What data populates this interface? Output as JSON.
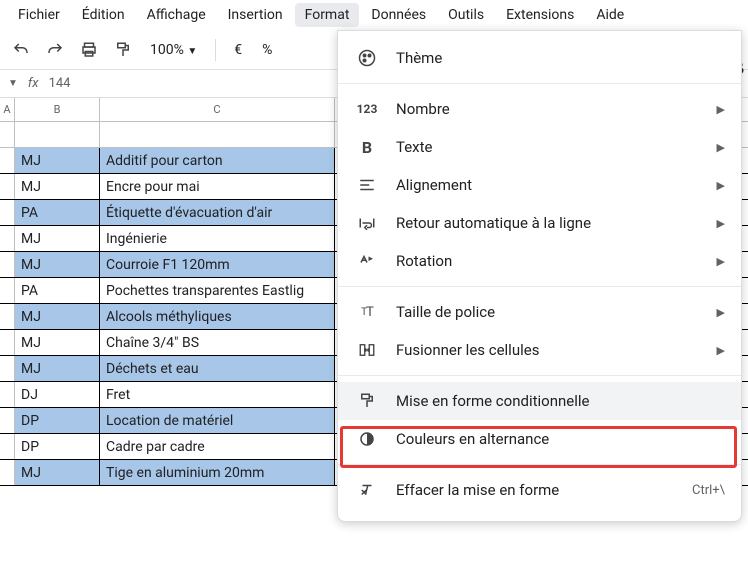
{
  "menubar": [
    "Fichier",
    "Édition",
    "Affichage",
    "Insertion",
    "Format",
    "Données",
    "Outils",
    "Extensions",
    "Aide"
  ],
  "menubar_active_index": 4,
  "toolbar": {
    "zoom": "100%",
    "currency": "€",
    "percent": "%"
  },
  "formula_bar": {
    "fx": "fx",
    "value": "144"
  },
  "columns": {
    "a": "A",
    "b": "B",
    "c": "C"
  },
  "rows": [
    {
      "band": true,
      "b": "MJ",
      "c": "Additif pour carton"
    },
    {
      "band": false,
      "b": "MJ",
      "c": "Encre pour mai"
    },
    {
      "band": true,
      "b": "PA",
      "c": "Étiquette d'évacuation d'air"
    },
    {
      "band": false,
      "b": "MJ",
      "c": "Ingénierie"
    },
    {
      "band": true,
      "b": "MJ",
      "c": "Courroie F1 120mm"
    },
    {
      "band": false,
      "b": "PA",
      "c": "Pochettes transparentes Eastlig"
    },
    {
      "band": true,
      "b": "MJ",
      "c": "Alcools méthyliques"
    },
    {
      "band": false,
      "b": "MJ",
      "c": "Chaîne 3/4\" BS"
    },
    {
      "band": true,
      "b": "MJ",
      "c": "Déchets et eau"
    },
    {
      "band": false,
      "b": "DJ",
      "c": "Fret"
    },
    {
      "band": true,
      "b": "DP",
      "c": "Location de matériel"
    },
    {
      "band": false,
      "b": "DP",
      "c": "Cadre par cadre"
    },
    {
      "band": true,
      "b": "MJ",
      "c": "Tige en aluminium 20mm"
    }
  ],
  "dropdown": {
    "theme": "Thème",
    "number": "Nombre",
    "text": "Texte",
    "align": "Alignement",
    "wrap": "Retour automatique à la ligne",
    "rotate": "Rotation",
    "fontsize": "Taille de police",
    "merge": "Fusionner les cellules",
    "conditional": "Mise en forme conditionnelle",
    "altcolors": "Couleurs en alternance",
    "clear": "Effacer la mise en forme",
    "clear_shortcut": "Ctrl+\\"
  },
  "bold_b": "B"
}
